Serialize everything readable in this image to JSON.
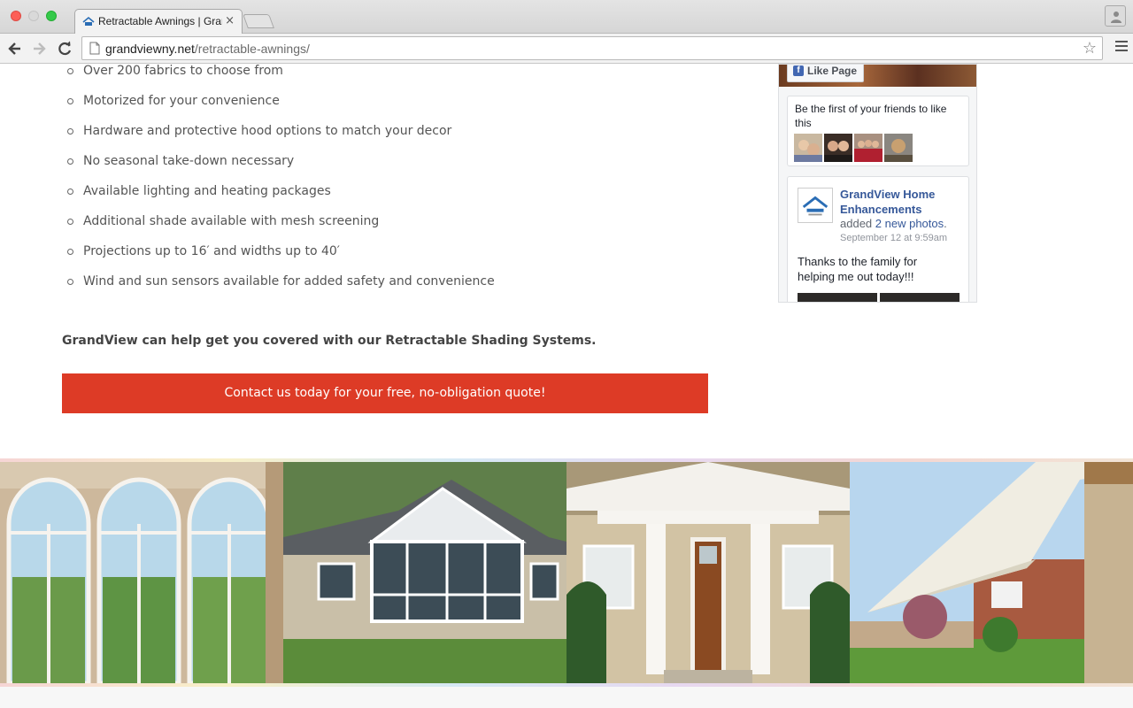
{
  "browser": {
    "tab_title": "Retractable Awnings | Gran",
    "tab_close": "×",
    "url_domain": "grandviewny.net",
    "url_path": "/retractable-awnings/",
    "star": "☆"
  },
  "features": [
    "Over 200 fabrics to choose from",
    "Motorized for your convenience",
    "Hardware and protective hood options to match your decor",
    "No seasonal take-down necessary",
    "Available lighting and heating packages",
    "Additional shade available with mesh screening",
    "Projections up to 16′ and widths up to 40′",
    "Wind and sun sensors available for added safety and convenience"
  ],
  "tagline": "GrandView can help get you covered with our Retractable Shading Systems.",
  "cta": {
    "label": "Contact us today for your free, no-obligation quote!",
    "color": "#dd3b26"
  },
  "facebook": {
    "like_label": "Like Page",
    "friends_text": "Be the first of your friends to like this",
    "page_name": "GrandView Home Enhancements",
    "added_prefix": "added",
    "added_link": "2 new photos",
    "added_suffix": ".",
    "timestamp": "September 12 at 9:59am",
    "message": "Thanks to the family for helping me out today!!!"
  },
  "gallery": [
    {
      "name": "arched-windows-photo"
    },
    {
      "name": "sunroom-addition-photo"
    },
    {
      "name": "front-porch-door-photo"
    },
    {
      "name": "retractable-awning-patio-photo"
    }
  ]
}
